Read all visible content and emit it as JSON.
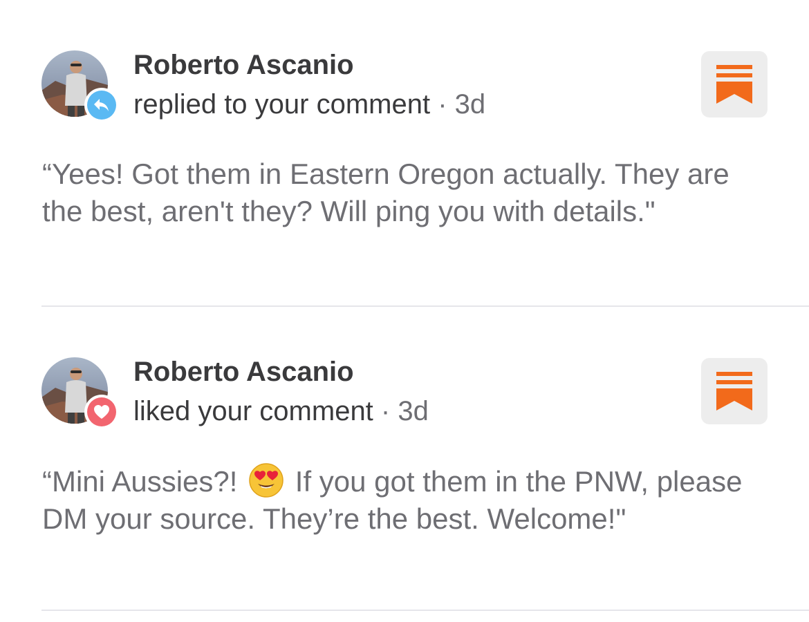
{
  "colors": {
    "reply_badge": "#5ab9f3",
    "like_badge": "#f2656f",
    "bookmark_accent": "#f26a1b",
    "bookmark_bg": "#ededed",
    "author_text": "#3a3a3c",
    "quote_text": "#6e6e73",
    "divider": "#e5e5ea"
  },
  "notifications": [
    {
      "author": "Roberto Ascanio",
      "action": "replied to your comment",
      "separator": "·",
      "time": "3d",
      "badge_icon": "reply-arrow-icon",
      "action_icon": "bookmark-icon",
      "quote": "“Yees! Got them in Eastern Oregon actually. They are the best, aren't they? Will ping you with details.\""
    },
    {
      "author": "Roberto Ascanio",
      "action": "liked your comment",
      "separator": "·",
      "time": "3d",
      "badge_icon": "heart-icon",
      "action_icon": "bookmark-icon",
      "quote_before_emoji": "“Mini Aussies?!",
      "emoji": "heart-eyes-emoji",
      "quote_after_emoji": "If you got them in the PNW, please DM your source. They’re the best. Welcome!\""
    }
  ]
}
